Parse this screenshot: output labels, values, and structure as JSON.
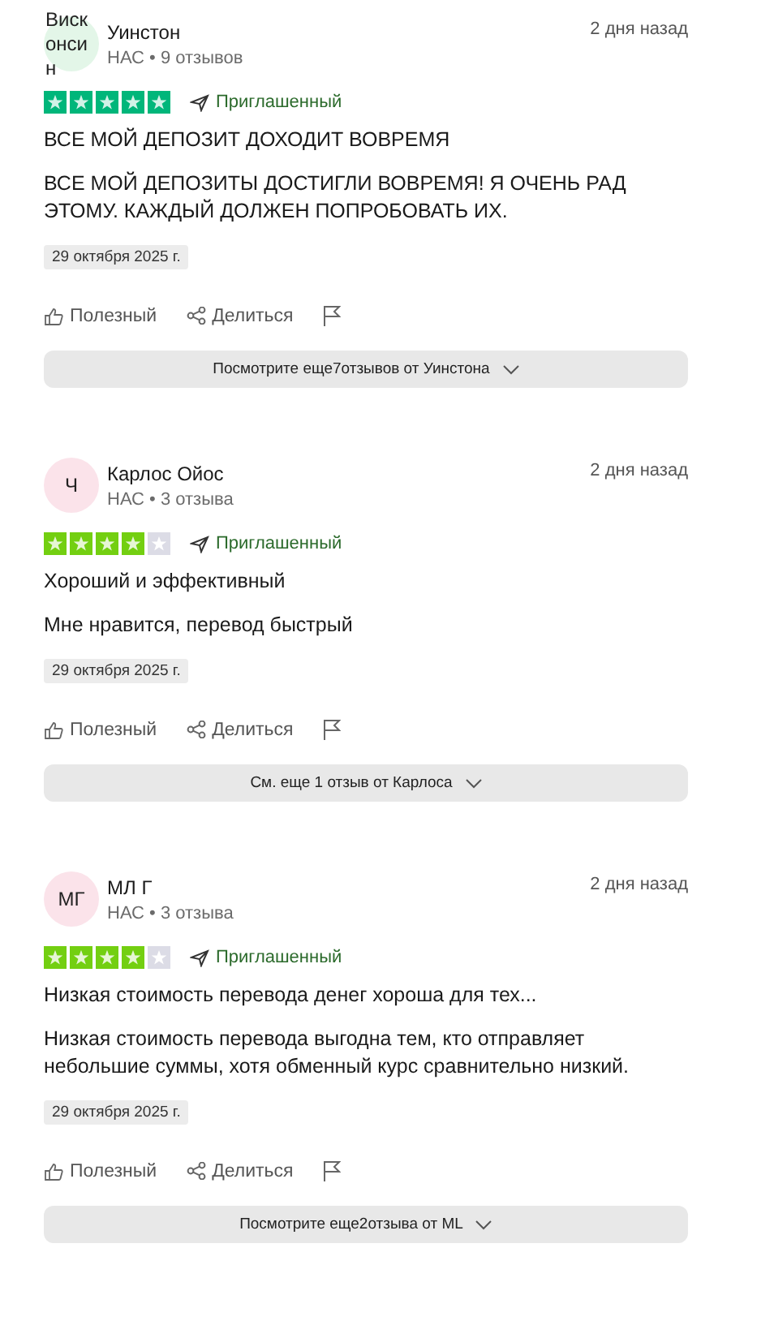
{
  "reviews": [
    {
      "avatar": {
        "text": "Висконсин",
        "color": "#e3f6e8"
      },
      "name": "Уинстон",
      "meta": "НАС • 9 отзывов",
      "time": "2 дня назад",
      "stars": 5,
      "badge": "Приглашенный",
      "title": "ВСЕ МОЙ ДЕПОЗИТ ДОХОДИТ ВОВРЕМЯ",
      "body": "ВСЕ МОЙ ДЕПОЗИТЫ ДОСТИГЛИ ВОВРЕМЯ! Я ОЧЕНЬ РАД ЭТОМУ. КАЖДЫЙ ДОЛЖЕН ПОПРОБОВАТЬ ИХ.",
      "date": "29 октября 2025 г.",
      "useful": "Полезный",
      "share": "Делиться",
      "more": "Посмотрите еще7отзывов от Уинстона"
    },
    {
      "avatar": {
        "text": "Ч",
        "color": "#fbe3ea"
      },
      "name": "Карлос Ойос",
      "meta": "НАС • 3 отзыва",
      "time": "2 дня назад",
      "stars": 4,
      "badge": "Приглашенный",
      "title": "Хороший и эффективный",
      "body": "Мне нравится, перевод быстрый",
      "date": "29 октября 2025 г.",
      "useful": "Полезный",
      "share": "Делиться",
      "more": "См. еще 1 отзыв от Карлоса"
    },
    {
      "avatar": {
        "text": "МГ",
        "color": "#fbe3ea"
      },
      "name": "МЛ Г",
      "meta": "НАС • 3 отзыва",
      "time": "2 дня назад",
      "stars": 4,
      "badge": "Приглашенный",
      "title": "Низкая стоимость перевода денег хороша для тех...",
      "body": "Низкая стоимость перевода выгодна тем, кто отправляет небольшие суммы, хотя обменный курс сравнительно низкий.",
      "date": "29 октября 2025 г.",
      "useful": "Полезный",
      "share": "Делиться",
      "more": "Посмотрите еще2отзыва от ML"
    }
  ]
}
